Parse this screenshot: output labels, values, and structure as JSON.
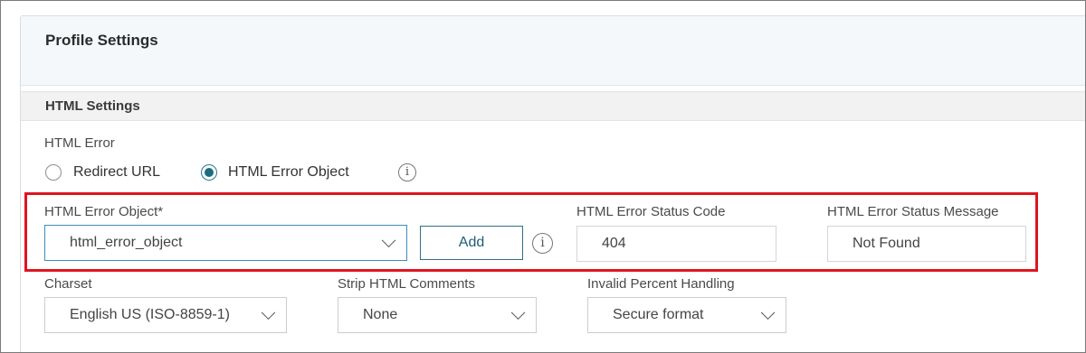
{
  "panel": {
    "title": "Profile Settings"
  },
  "section": {
    "title": "HTML Settings"
  },
  "html_error": {
    "label": "HTML Error",
    "options": [
      {
        "label": "Redirect URL",
        "selected": false
      },
      {
        "label": "HTML Error Object",
        "selected": true
      }
    ]
  },
  "error_object": {
    "label": "HTML Error Object*",
    "value": "html_error_object",
    "add_label": "Add"
  },
  "status_code": {
    "label": "HTML Error Status Code",
    "value": "404"
  },
  "status_message": {
    "label": "HTML Error Status Message",
    "value": "Not Found"
  },
  "charset": {
    "label": "Charset",
    "value": "English US (ISO-8859-1)"
  },
  "strip_comments": {
    "label": "Strip HTML Comments",
    "value": "None"
  },
  "invalid_percent": {
    "label": "Invalid Percent Handling",
    "value": "Secure format"
  },
  "icons": {
    "info": "info-icon",
    "chevron": "chevron-down-icon"
  },
  "colors": {
    "accent": "#1c6c80",
    "highlight": "#e0141e"
  }
}
